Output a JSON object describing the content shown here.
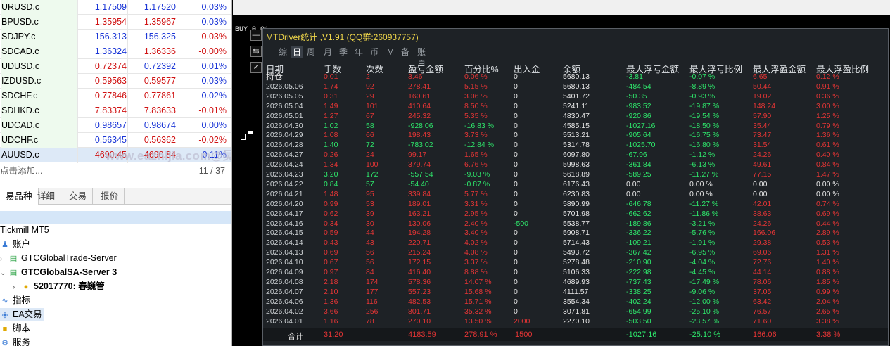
{
  "quotes": [
    {
      "symbol": "URUSD.c",
      "bid": "1.17509",
      "ask": "1.17520",
      "change": "0.03%",
      "bid_color": "blue",
      "ask_color": "blue",
      "change_color": "blue"
    },
    {
      "symbol": "BPUSD.c",
      "bid": "1.35954",
      "ask": "1.35967",
      "change": "0.03%",
      "bid_color": "red",
      "ask_color": "red",
      "change_color": "blue"
    },
    {
      "symbol": "SDJPY.c",
      "bid": "156.313",
      "ask": "156.325",
      "change": "-0.03%",
      "bid_color": "blue",
      "ask_color": "blue",
      "change_color": "red"
    },
    {
      "symbol": "SDCAD.c",
      "bid": "1.36324",
      "ask": "1.36336",
      "change": "-0.00%",
      "bid_color": "blue",
      "ask_color": "red",
      "change_color": "red"
    },
    {
      "symbol": "UDUSD.c",
      "bid": "0.72374",
      "ask": "0.72392",
      "change": "0.01%",
      "bid_color": "red",
      "ask_color": "blue",
      "change_color": "blue"
    },
    {
      "symbol": "IZDUSD.c",
      "bid": "0.59563",
      "ask": "0.59577",
      "change": "0.03%",
      "bid_color": "red",
      "ask_color": "red",
      "change_color": "blue"
    },
    {
      "symbol": "SDCHF.c",
      "bid": "0.77846",
      "ask": "0.77861",
      "change": "0.02%",
      "bid_color": "red",
      "ask_color": "red",
      "change_color": "blue"
    },
    {
      "symbol": "SDHKD.c",
      "bid": "7.83374",
      "ask": "7.83633",
      "change": "-0.01%",
      "bid_color": "red",
      "ask_color": "red",
      "change_color": "red"
    },
    {
      "symbol": "UDCAD.c",
      "bid": "0.98657",
      "ask": "0.98674",
      "change": "0.00%",
      "bid_color": "blue",
      "ask_color": "blue",
      "change_color": "blue"
    },
    {
      "symbol": "UDCHF.c",
      "bid": "0.56345",
      "ask": "0.56362",
      "change": "-0.02%",
      "bid_color": "blue",
      "ask_color": "red",
      "change_color": "red"
    },
    {
      "symbol": "AUUSD.c",
      "bid": "4690.45",
      "ask": "4690.84",
      "change": "0.11%",
      "bid_color": "red",
      "ask_color": "red",
      "change_color": "blue"
    }
  ],
  "watermark": "www.eazhijia.com@吴大大666",
  "add_row": {
    "label": "点击添加...",
    "count": "11 / 37"
  },
  "bottom_tabs": [
    "易品种",
    "详细",
    "交易",
    "报价"
  ],
  "navigator": {
    "account_name": "Tickmill MT5",
    "items": [
      {
        "label": "账户"
      },
      {
        "label": "GTCGlobalTrade-Server"
      },
      {
        "label": "GTCGlobalSA-Server 3"
      },
      {
        "label": "52017770: 春巍管"
      },
      {
        "label": "指标"
      },
      {
        "label": "EA交易"
      },
      {
        "label": "脚本"
      },
      {
        "label": "服务"
      }
    ]
  },
  "chart": {
    "buy_label": "BUY 0.01"
  },
  "panel": {
    "title": "MTDriver统计 ,V1.91 (QQ群:260937757)",
    "tabs": [
      "综",
      "日",
      "周",
      "月",
      "季",
      "年",
      "币",
      "M",
      "备",
      "账户"
    ],
    "active_tab": "日",
    "headers": [
      "日期",
      "手数",
      "次数",
      "盈亏金额",
      "百分比%",
      "出入金",
      "余额",
      "最大浮亏金额",
      "最大浮亏比例",
      "最大浮盈金额",
      "最大浮盈比例"
    ],
    "rows": [
      {
        "date": "持仓",
        "lots": "0.01",
        "count": "2",
        "pnl": "3.46",
        "pct": "0.06 %",
        "io": "0",
        "balance": "5680.13",
        "max_dd": "-3.81",
        "max_dd_pct": "-0.07 %",
        "max_fp": "6.65",
        "max_fp_pct": "0.12 %",
        "dir": "up"
      },
      {
        "date": "2026.05.06",
        "lots": "1.74",
        "count": "92",
        "pnl": "278.41",
        "pct": "5.15 %",
        "io": "0",
        "balance": "5680.13",
        "max_dd": "-484.54",
        "max_dd_pct": "-8.89 %",
        "max_fp": "50.44",
        "max_fp_pct": "0.91 %",
        "dir": "up"
      },
      {
        "date": "2026.05.05",
        "lots": "0.31",
        "count": "29",
        "pnl": "160.61",
        "pct": "3.06 %",
        "io": "0",
        "balance": "5401.72",
        "max_dd": "-50.35",
        "max_dd_pct": "-0.93 %",
        "max_fp": "19.02",
        "max_fp_pct": "0.36 %",
        "dir": "up"
      },
      {
        "date": "2026.05.04",
        "lots": "1.49",
        "count": "101",
        "pnl": "410.64",
        "pct": "8.50 %",
        "io": "0",
        "balance": "5241.11",
        "max_dd": "-983.52",
        "max_dd_pct": "-19.87 %",
        "max_fp": "148.24",
        "max_fp_pct": "3.00 %",
        "dir": "up"
      },
      {
        "date": "2026.05.01",
        "lots": "1.27",
        "count": "67",
        "pnl": "245.32",
        "pct": "5.35 %",
        "io": "0",
        "balance": "4830.47",
        "max_dd": "-920.86",
        "max_dd_pct": "-19.54 %",
        "max_fp": "57.90",
        "max_fp_pct": "1.25 %",
        "dir": "up"
      },
      {
        "date": "2026.04.30",
        "lots": "1.02",
        "count": "58",
        "pnl": "-928.06",
        "pct": "-16.83 %",
        "io": "0",
        "balance": "4585.15",
        "max_dd": "-1027.16",
        "max_dd_pct": "-18.50 %",
        "max_fp": "35.44",
        "max_fp_pct": "0.79 %",
        "dir": "down"
      },
      {
        "date": "2026.04.29",
        "lots": "1.08",
        "count": "66",
        "pnl": "198.43",
        "pct": "3.73 %",
        "io": "0",
        "balance": "5513.21",
        "max_dd": "-905.64",
        "max_dd_pct": "-16.75 %",
        "max_fp": "73.47",
        "max_fp_pct": "1.36 %",
        "dir": "up"
      },
      {
        "date": "2026.04.28",
        "lots": "1.40",
        "count": "72",
        "pnl": "-783.02",
        "pct": "-12.84 %",
        "io": "0",
        "balance": "5314.78",
        "max_dd": "-1025.70",
        "max_dd_pct": "-16.80 %",
        "max_fp": "31.54",
        "max_fp_pct": "0.61 %",
        "dir": "down"
      },
      {
        "date": "2026.04.27",
        "lots": "0.26",
        "count": "24",
        "pnl": "99.17",
        "pct": "1.65 %",
        "io": "0",
        "balance": "6097.80",
        "max_dd": "-67.96",
        "max_dd_pct": "-1.12 %",
        "max_fp": "24.26",
        "max_fp_pct": "0.40 %",
        "dir": "up"
      },
      {
        "date": "2026.04.24",
        "lots": "1.34",
        "count": "100",
        "pnl": "379.74",
        "pct": "6.76 %",
        "io": "0",
        "balance": "5998.63",
        "max_dd": "-361.84",
        "max_dd_pct": "-6.13 %",
        "max_fp": "49.61",
        "max_fp_pct": "0.84 %",
        "dir": "up"
      },
      {
        "date": "2026.04.23",
        "lots": "3.20",
        "count": "172",
        "pnl": "-557.54",
        "pct": "-9.03 %",
        "io": "0",
        "balance": "5618.89",
        "max_dd": "-589.25",
        "max_dd_pct": "-11.27 %",
        "max_fp": "77.15",
        "max_fp_pct": "1.47 %",
        "dir": "down"
      },
      {
        "date": "2026.04.22",
        "lots": "0.84",
        "count": "57",
        "pnl": "-54.40",
        "pct": "-0.87 %",
        "io": "0",
        "balance": "6176.43",
        "max_dd": "0.00",
        "max_dd_pct": "0.00 %",
        "max_fp": "0.00",
        "max_fp_pct": "0.00 %",
        "dir": "down"
      },
      {
        "date": "2026.04.21",
        "lots": "1.48",
        "count": "95",
        "pnl": "339.84",
        "pct": "5.77 %",
        "io": "0",
        "balance": "6230.83",
        "max_dd": "0.00",
        "max_dd_pct": "0.00 %",
        "max_fp": "0.00",
        "max_fp_pct": "0.00 %",
        "dir": "up"
      },
      {
        "date": "2026.04.20",
        "lots": "0.99",
        "count": "53",
        "pnl": "189.01",
        "pct": "3.31 %",
        "io": "0",
        "balance": "5890.99",
        "max_dd": "-646.78",
        "max_dd_pct": "-11.27 %",
        "max_fp": "42.01",
        "max_fp_pct": "0.74 %",
        "dir": "up"
      },
      {
        "date": "2026.04.17",
        "lots": "0.62",
        "count": "39",
        "pnl": "163.21",
        "pct": "2.95 %",
        "io": "0",
        "balance": "5701.98",
        "max_dd": "-662.62",
        "max_dd_pct": "-11.86 %",
        "max_fp": "38.63",
        "max_fp_pct": "0.69 %",
        "dir": "up"
      },
      {
        "date": "2026.04.16",
        "lots": "0.34",
        "count": "30",
        "pnl": "130.06",
        "pct": "2.40 %",
        "io": "-500",
        "balance": "5538.77",
        "max_dd": "-189.86",
        "max_dd_pct": "-3.21 %",
        "max_fp": "24.26",
        "max_fp_pct": "0.44 %",
        "dir": "up",
        "io_green": true
      },
      {
        "date": "2026.04.15",
        "lots": "0.59",
        "count": "44",
        "pnl": "194.28",
        "pct": "3.40 %",
        "io": "0",
        "balance": "5908.71",
        "max_dd": "-336.22",
        "max_dd_pct": "-5.76 %",
        "max_fp": "166.06",
        "max_fp_pct": "2.89 %",
        "dir": "up"
      },
      {
        "date": "2026.04.14",
        "lots": "0.43",
        "count": "43",
        "pnl": "220.71",
        "pct": "4.02 %",
        "io": "0",
        "balance": "5714.43",
        "max_dd": "-109.21",
        "max_dd_pct": "-1.91 %",
        "max_fp": "29.38",
        "max_fp_pct": "0.53 %",
        "dir": "up"
      },
      {
        "date": "2026.04.13",
        "lots": "0.69",
        "count": "56",
        "pnl": "215.24",
        "pct": "4.08 %",
        "io": "0",
        "balance": "5493.72",
        "max_dd": "-367.42",
        "max_dd_pct": "-6.95 %",
        "max_fp": "69.06",
        "max_fp_pct": "1.31 %",
        "dir": "up"
      },
      {
        "date": "2026.04.10",
        "lots": "0.67",
        "count": "56",
        "pnl": "172.15",
        "pct": "3.37 %",
        "io": "0",
        "balance": "5278.48",
        "max_dd": "-210.90",
        "max_dd_pct": "-4.04 %",
        "max_fp": "72.76",
        "max_fp_pct": "1.40 %",
        "dir": "up"
      },
      {
        "date": "2026.04.09",
        "lots": "0.97",
        "count": "84",
        "pnl": "416.40",
        "pct": "8.88 %",
        "io": "0",
        "balance": "5106.33",
        "max_dd": "-222.98",
        "max_dd_pct": "-4.45 %",
        "max_fp": "44.14",
        "max_fp_pct": "0.88 %",
        "dir": "up"
      },
      {
        "date": "2026.04.08",
        "lots": "2.18",
        "count": "174",
        "pnl": "578.36",
        "pct": "14.07 %",
        "io": "0",
        "balance": "4689.93",
        "max_dd": "-737.43",
        "max_dd_pct": "-17.49 %",
        "max_fp": "78.06",
        "max_fp_pct": "1.85 %",
        "dir": "up"
      },
      {
        "date": "2026.04.07",
        "lots": "2.10",
        "count": "177",
        "pnl": "557.23",
        "pct": "15.68 %",
        "io": "0",
        "balance": "4111.57",
        "max_dd": "-338.25",
        "max_dd_pct": "-9.06 %",
        "max_fp": "37.05",
        "max_fp_pct": "0.99 %",
        "dir": "up"
      },
      {
        "date": "2026.04.06",
        "lots": "1.36",
        "count": "116",
        "pnl": "482.53",
        "pct": "15.71 %",
        "io": "0",
        "balance": "3554.34",
        "max_dd": "-402.24",
        "max_dd_pct": "-12.00 %",
        "max_fp": "63.42",
        "max_fp_pct": "2.04 %",
        "dir": "up"
      },
      {
        "date": "2026.04.02",
        "lots": "3.66",
        "count": "256",
        "pnl": "801.71",
        "pct": "35.32 %",
        "io": "0",
        "balance": "3071.81",
        "max_dd": "-654.99",
        "max_dd_pct": "-25.10 %",
        "max_fp": "76.57",
        "max_fp_pct": "2.65 %",
        "dir": "up"
      },
      {
        "date": "2026.04.01",
        "lots": "1.16",
        "count": "78",
        "pnl": "270.10",
        "pct": "13.50 %",
        "io": "2000",
        "balance": "2270.10",
        "max_dd": "-503.50",
        "max_dd_pct": "-23.57 %",
        "max_fp": "71.60",
        "max_fp_pct": "3.38 %",
        "dir": "up",
        "io_red": true
      }
    ],
    "total": {
      "label": "合计",
      "lots": "31.20",
      "pnl": "4183.59",
      "pct": "278.91 %",
      "io": "1500",
      "max_dd": "-1027.16",
      "max_dd_pct": "-25.10 %",
      "max_fp": "166.06",
      "max_fp_pct": "3.38 %"
    }
  },
  "colors": {
    "up": "#e53535",
    "down": "#2ee66b",
    "panel_bg": "#1e2226",
    "title": "#f0d74a"
  }
}
